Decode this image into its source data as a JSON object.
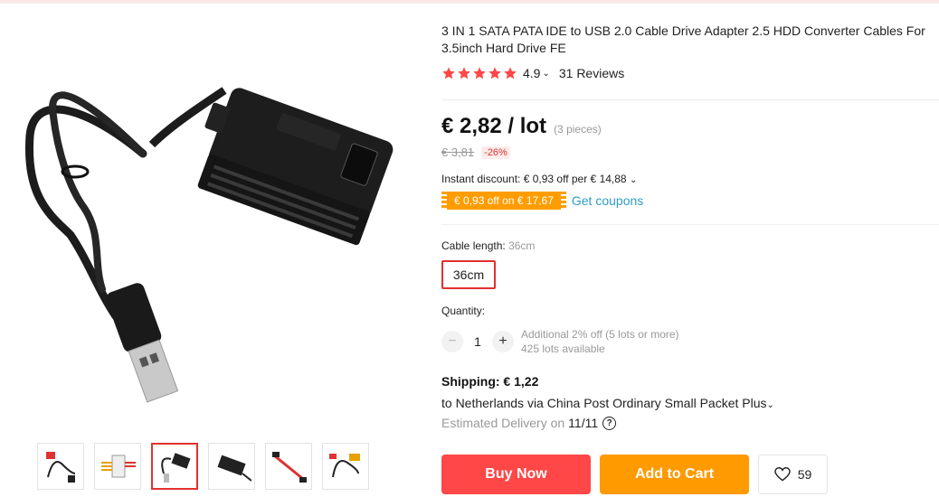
{
  "product": {
    "title": "3 IN 1 SATA PATA IDE to USB 2.0 Cable Drive Adapter 2.5 HDD Converter Cables For 3.5inch Hard Drive FE",
    "rating": {
      "stars": 5,
      "value": "4.9",
      "reviews_label": "31 Reviews"
    },
    "price": {
      "current": "€ 2,82 / lot",
      "pieces": "(3 pieces)",
      "original": "€ 3,81",
      "discount": "-26%"
    },
    "instant_discount": "Instant discount: € 0,93 off per € 14,88",
    "coupon": {
      "label": "€ 0,93 off on € 17,67",
      "link": "Get coupons"
    },
    "cable_length": {
      "label": "Cable length:",
      "selected": "36cm",
      "options": [
        "36cm"
      ]
    },
    "quantity": {
      "label": "Quantity:",
      "value": "1",
      "minus": "−",
      "plus": "+",
      "info_line1": "Additional 2% off (5 lots or more)",
      "info_line2": "425 lots available"
    },
    "shipping": {
      "title": "Shipping: € 1,22",
      "to": "to Netherlands via China Post Ordinary Small Packet Plus",
      "estimated_label": "Estimated Delivery on",
      "estimated_date": "11/11",
      "help": "?"
    },
    "actions": {
      "buy_now": "Buy Now",
      "add_to_cart": "Add to Cart",
      "wishlist_count": "59"
    }
  },
  "gallery": {
    "thumbnails": [
      "thumb-1",
      "thumb-2",
      "thumb-3",
      "thumb-4",
      "thumb-5",
      "thumb-6"
    ],
    "active_index": 2
  },
  "colors": {
    "accent_red": "#ff4747",
    "accent_orange": "#ff9a00",
    "link_blue": "#2e9cc3",
    "star_red": "#ff4747"
  }
}
